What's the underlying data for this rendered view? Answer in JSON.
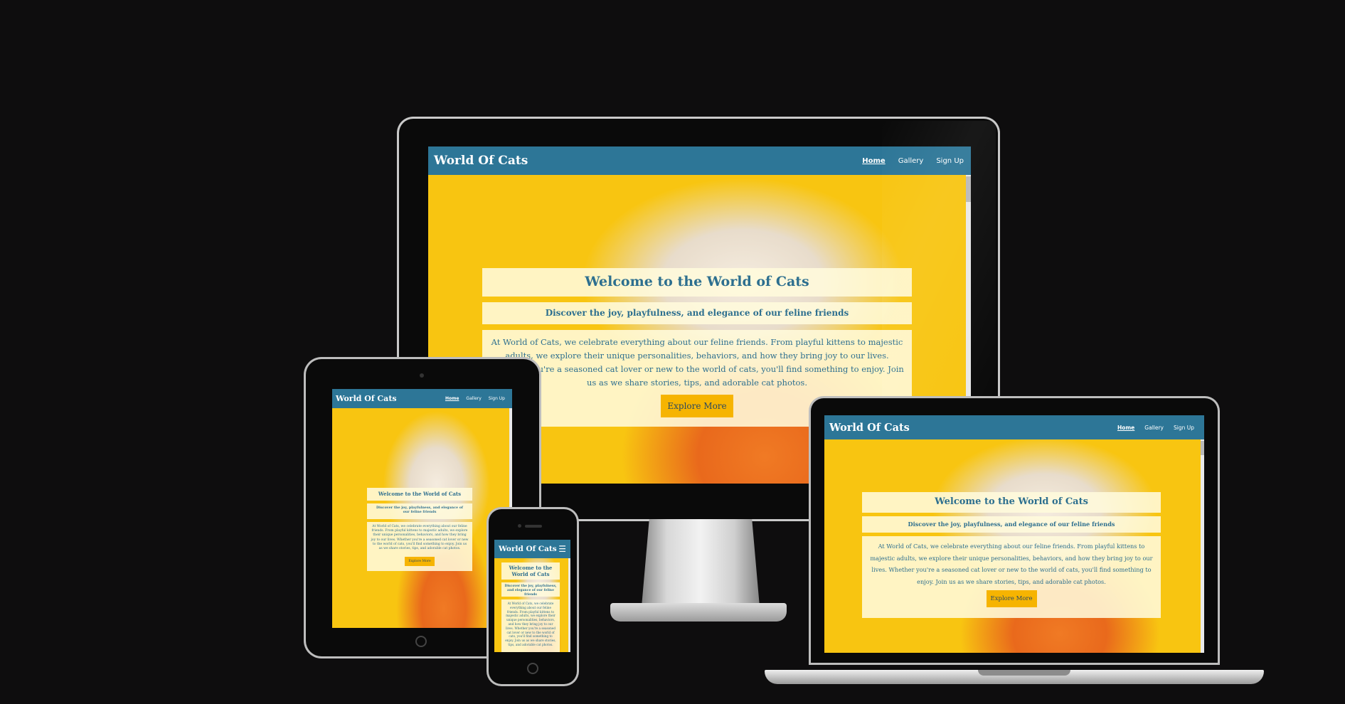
{
  "site": {
    "brand": "World Of Cats",
    "nav": [
      "Home",
      "Gallery",
      "Sign Up"
    ],
    "heading": "Welcome to the World of Cats",
    "subheading": "Discover the joy, playfulness, and elegance of our feline friends",
    "body": "At World of Cats, we celebrate everything about our feline friends. From playful kittens to majestic adults, we explore their unique personalities, behaviors, and how they bring joy to our lives. Whether you're a seasoned cat lover or new to the world of cats, you'll find something to enjoy. Join us as we share stories, tips, and adorable cat photos.",
    "button": "Explore More"
  },
  "icons": {
    "mobile_menu": "hamburger-menu-icon"
  },
  "colors": {
    "page_background": "#0e0d0e",
    "navbar": "#2d7697",
    "hero_yellow": "#f8c511",
    "accent_orange": "#f07a24",
    "content_text": "#2d6f8f",
    "button": "#f6b401"
  }
}
